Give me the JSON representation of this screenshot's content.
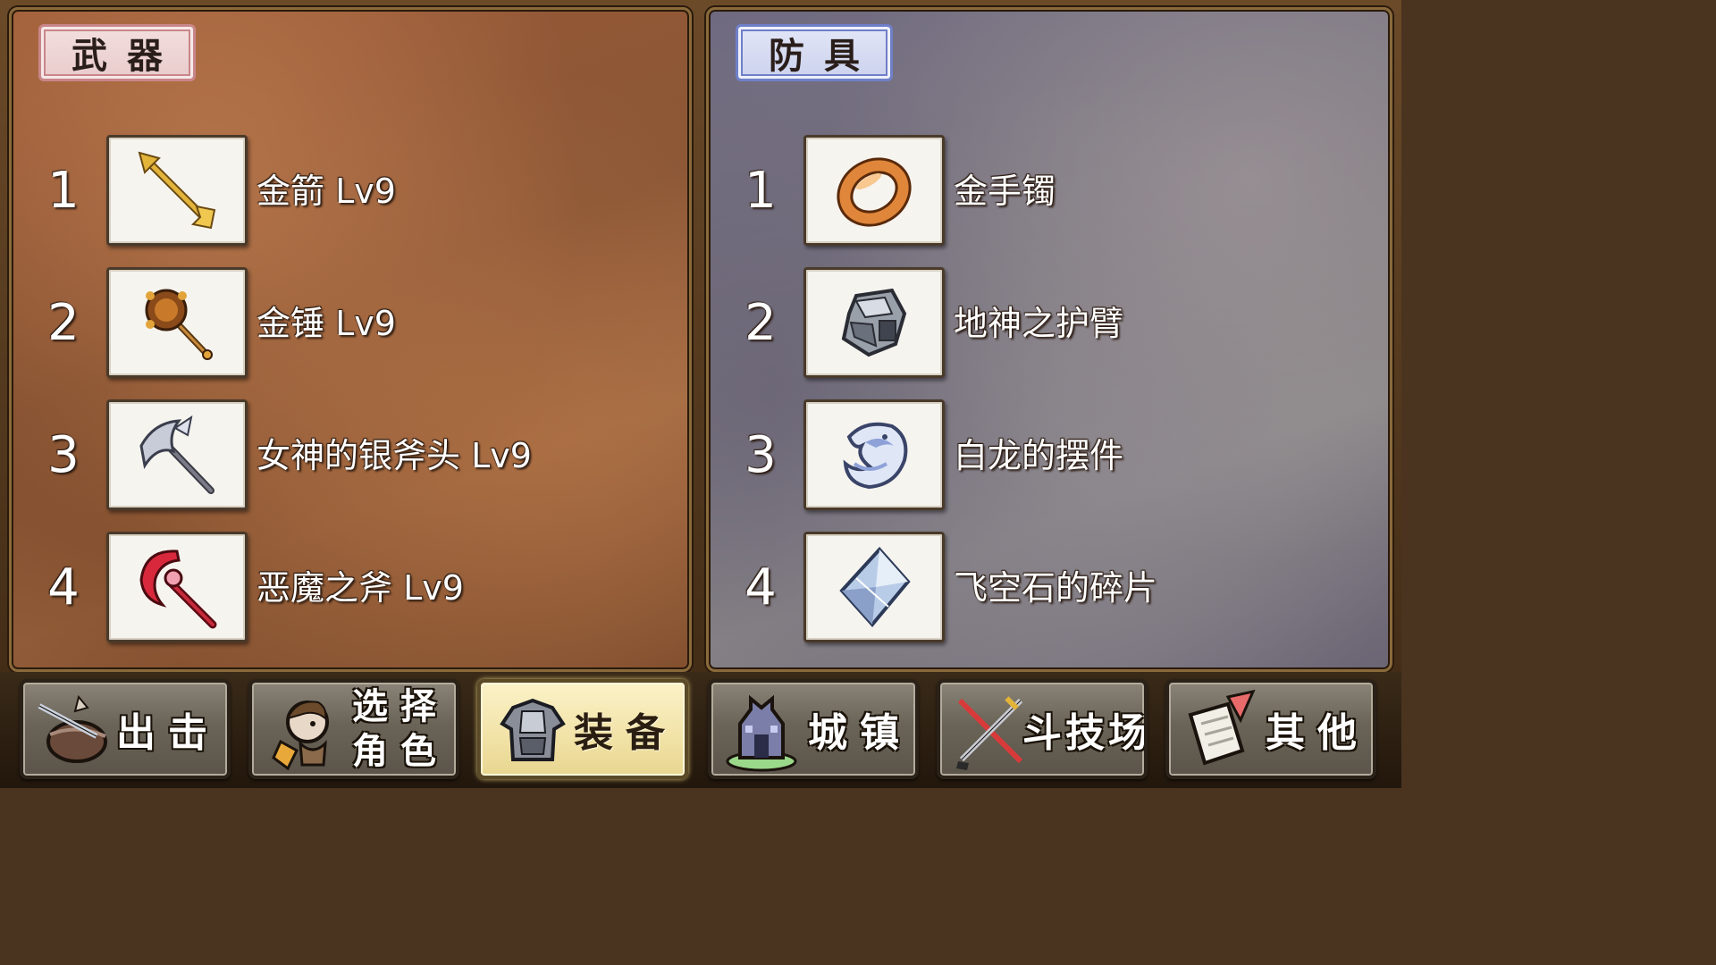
{
  "weapons_panel": {
    "tab_label": "武器",
    "items": [
      {
        "num": "1",
        "name": "金箭 Lv9",
        "icon": "golden-arrow-icon"
      },
      {
        "num": "2",
        "name": "金锤 Lv9",
        "icon": "golden-hammer-icon"
      },
      {
        "num": "3",
        "name": "女神的银斧头 Lv9",
        "icon": "silver-axe-icon"
      },
      {
        "num": "4",
        "name": "恶魔之斧 Lv9",
        "icon": "demon-axe-icon"
      }
    ]
  },
  "armor_panel": {
    "tab_label": "防具",
    "items": [
      {
        "num": "1",
        "name": "金手镯",
        "icon": "gold-bracelet-icon"
      },
      {
        "num": "2",
        "name": "地神之护臂",
        "icon": "gauntlet-icon"
      },
      {
        "num": "3",
        "name": "白龙的摆件",
        "icon": "white-dragon-icon"
      },
      {
        "num": "4",
        "name": "飞空石的碎片",
        "icon": "crystal-shard-icon"
      }
    ]
  },
  "navbar": {
    "buttons": [
      {
        "label": "出击",
        "icon": "sortie-icon",
        "active": false
      },
      {
        "label_line1": "选择",
        "label_line2": "角色",
        "icon": "character-icon",
        "active": false
      },
      {
        "label": "装备",
        "icon": "armor-icon",
        "active": true
      },
      {
        "label": "城镇",
        "icon": "town-icon",
        "active": false
      },
      {
        "label": "斗技场",
        "icon": "arena-swords-icon",
        "active": false
      },
      {
        "label": "其他",
        "icon": "scroll-icon",
        "active": false
      }
    ]
  },
  "colors": {
    "weapon_tab_border": "#c9868a",
    "armor_tab_border": "#6f7fc8",
    "active_nav": "#f1e2a6"
  }
}
